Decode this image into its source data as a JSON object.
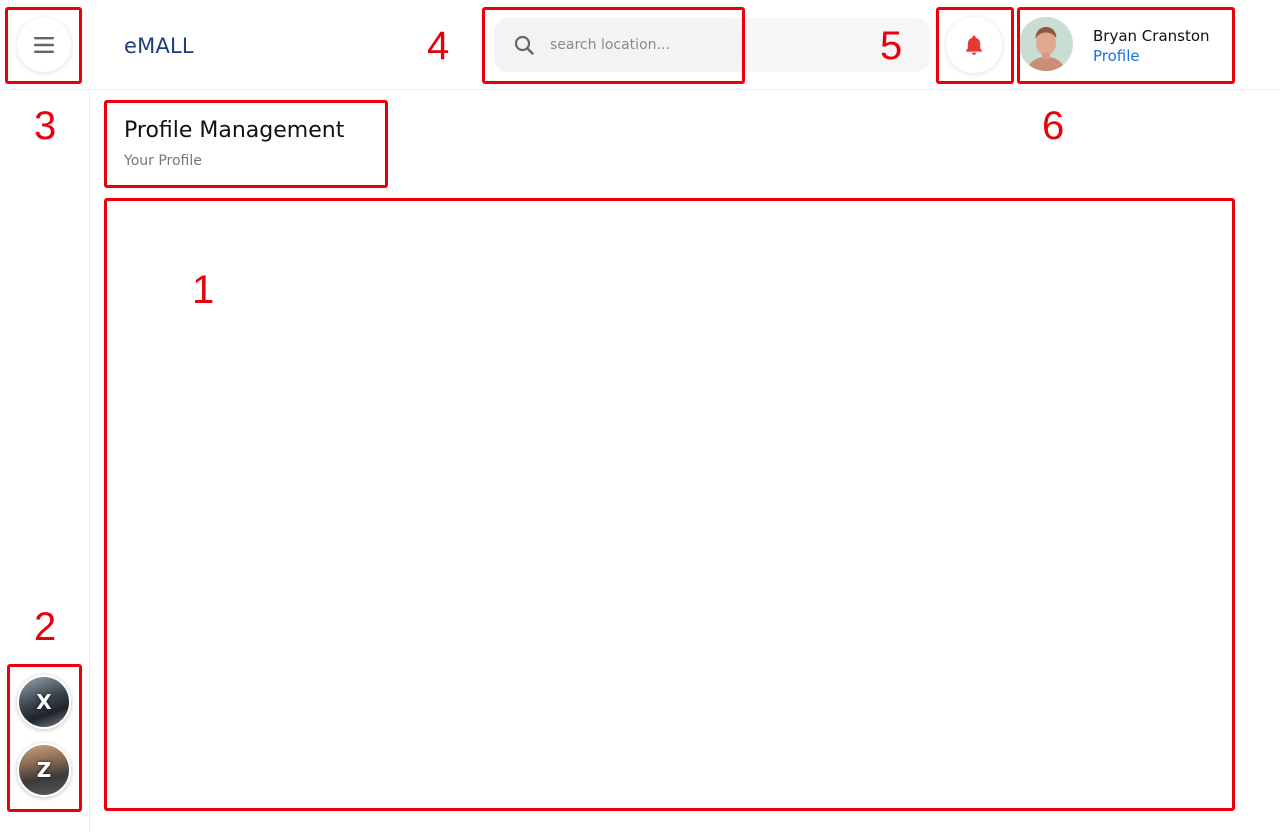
{
  "header": {
    "logo": "eMALL",
    "search": {
      "placeholder": "search location...",
      "value": ""
    },
    "user": {
      "name": "Bryan Cranston",
      "link": "Profile"
    }
  },
  "sidebar": {
    "stores": [
      {
        "letter": "X"
      },
      {
        "letter": "Z"
      }
    ]
  },
  "page": {
    "title": "Profile Management",
    "subtitle": "Your Profile"
  },
  "annotations": [
    "1",
    "2",
    "3",
    "4",
    "5",
    "6"
  ],
  "colors": {
    "accent": "#1a73e8",
    "logo": "#1b3f7a",
    "bell": "#e53935",
    "annotation": "#e8000b"
  },
  "icons": [
    "menu-icon",
    "search-icon",
    "bell-icon"
  ]
}
